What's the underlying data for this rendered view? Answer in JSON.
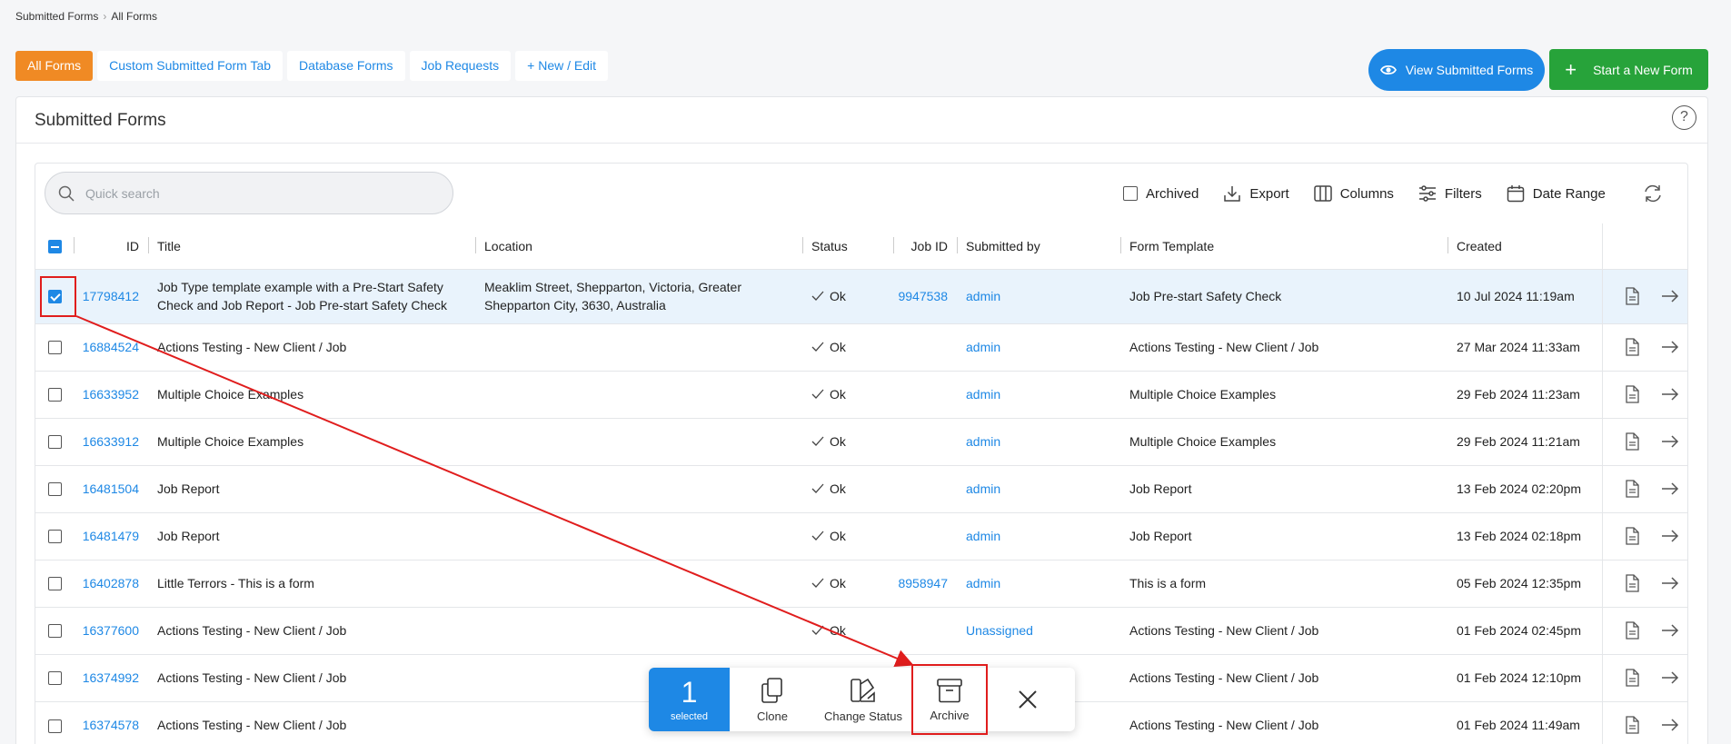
{
  "breadcrumb": [
    "Submitted Forms",
    "All Forms"
  ],
  "tabs": [
    {
      "label": "All Forms",
      "active": true
    },
    {
      "label": "Custom Submitted Form Tab",
      "active": false
    },
    {
      "label": "Database Forms",
      "active": false
    },
    {
      "label": "Job Requests",
      "active": false
    },
    {
      "label": "+ New / Edit",
      "active": false
    }
  ],
  "header_buttons": {
    "view_submitted": "View Submitted Forms",
    "start_new": "Start a New Form"
  },
  "card_title": "Submitted Forms",
  "help_icon": "?",
  "search": {
    "placeholder": "Quick search",
    "value": ""
  },
  "toolbar": {
    "archived": "Archived",
    "export": "Export",
    "columns": "Columns",
    "filters": "Filters",
    "date_range": "Date Range"
  },
  "columns": [
    "ID",
    "Title",
    "Location",
    "Status",
    "Job ID",
    "Submitted by",
    "Form Template",
    "Created"
  ],
  "rows": [
    {
      "id": "17798412",
      "title": "Job Type template example with a Pre-Start Safety Check and Job Report - Job Pre-start Safety Check",
      "location": "Meaklim Street, Shepparton, Victoria, Greater Shepparton City, 3630, Australia",
      "status": "Ok",
      "job_id": "9947538",
      "submitted_by": "admin",
      "template": "Job Pre-start Safety Check",
      "created": "10 Jul 2024 11:19am",
      "checked": true
    },
    {
      "id": "16884524",
      "title": "Actions Testing - New Client / Job",
      "location": "",
      "status": "Ok",
      "job_id": "",
      "submitted_by": "admin",
      "template": "Actions Testing - New Client / Job",
      "created": "27 Mar 2024 11:33am",
      "checked": false
    },
    {
      "id": "16633952",
      "title": "Multiple Choice Examples",
      "location": "",
      "status": "Ok",
      "job_id": "",
      "submitted_by": "admin",
      "template": "Multiple Choice Examples",
      "created": "29 Feb 2024 11:23am",
      "checked": false
    },
    {
      "id": "16633912",
      "title": "Multiple Choice Examples",
      "location": "",
      "status": "Ok",
      "job_id": "",
      "submitted_by": "admin",
      "template": "Multiple Choice Examples",
      "created": "29 Feb 2024 11:21am",
      "checked": false
    },
    {
      "id": "16481504",
      "title": "Job Report",
      "location": "",
      "status": "Ok",
      "job_id": "",
      "submitted_by": "admin",
      "template": "Job Report",
      "created": "13 Feb 2024 02:20pm",
      "checked": false
    },
    {
      "id": "16481479",
      "title": "Job Report",
      "location": "",
      "status": "Ok",
      "job_id": "",
      "submitted_by": "admin",
      "template": "Job Report",
      "created": "13 Feb 2024 02:18pm",
      "checked": false
    },
    {
      "id": "16402878",
      "title": "Little Terrors - This is a form",
      "location": "",
      "status": "Ok",
      "job_id": "8958947",
      "submitted_by": "admin",
      "template": "This is a form",
      "created": "05 Feb 2024 12:35pm",
      "checked": false
    },
    {
      "id": "16377600",
      "title": "Actions Testing - New Client / Job",
      "location": "",
      "status": "Ok",
      "job_id": "",
      "submitted_by": "Unassigned",
      "template": "Actions Testing - New Client / Job",
      "created": "01 Feb 2024 02:45pm",
      "checked": false
    },
    {
      "id": "16374992",
      "title": "Actions Testing - New Client / Job",
      "location": "",
      "status": "",
      "job_id": "",
      "submitted_by": "",
      "template": "Actions Testing - New Client / Job",
      "created": "01 Feb 2024 12:10pm",
      "checked": false
    },
    {
      "id": "16374578",
      "title": "Actions Testing - New Client / Job",
      "location": "",
      "status": "",
      "job_id": "",
      "submitted_by": "",
      "template": "Actions Testing - New Client / Job",
      "created": "01 Feb 2024 11:49am",
      "checked": false
    }
  ],
  "action_bar": {
    "count": "1",
    "count_label": "selected",
    "clone": "Clone",
    "change_status": "Change Status",
    "archive": "Archive"
  },
  "colors": {
    "accent": "#1e88e5",
    "orange": "#f08a24",
    "green": "#27a33a",
    "annotation_red": "#e01d1d"
  }
}
